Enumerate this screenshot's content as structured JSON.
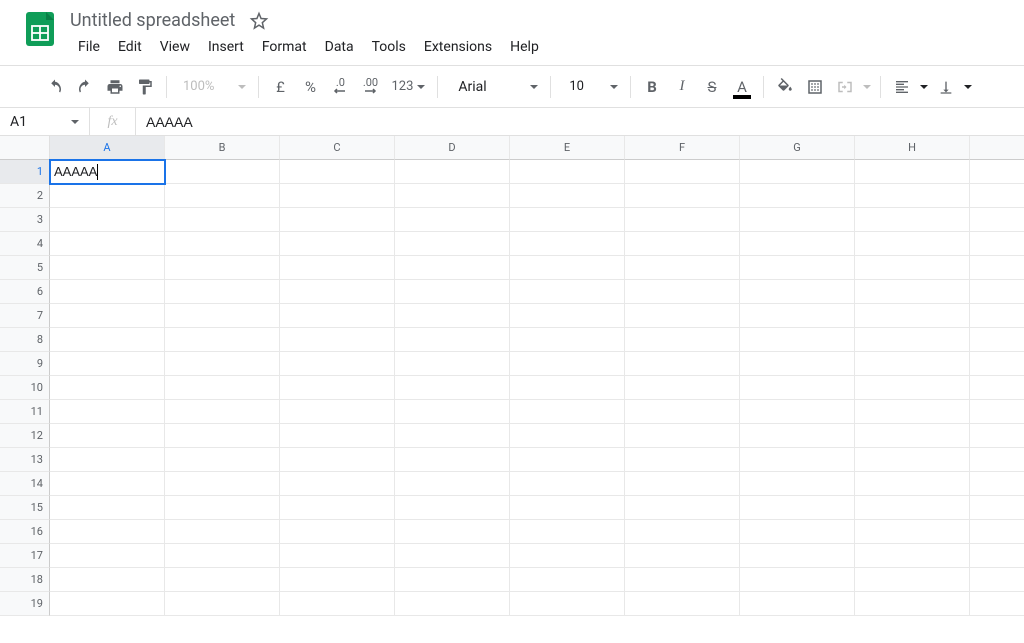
{
  "document": {
    "title": "Untitled spreadsheet"
  },
  "menu": {
    "items": [
      "File",
      "Edit",
      "View",
      "Insert",
      "Format",
      "Data",
      "Tools",
      "Extensions",
      "Help"
    ]
  },
  "toolbar": {
    "zoom": "100%",
    "currency": "£",
    "percent": "%",
    "decrease_decimal": ".0",
    "increase_decimal": ".00",
    "format_123": "123",
    "font": "Arial",
    "font_size": "10",
    "bold": "B",
    "italic": "I",
    "strike": "S"
  },
  "name_box": "A1",
  "formula_bar": {
    "fx": "fx",
    "value": "AAAAA"
  },
  "columns": [
    "A",
    "B",
    "C",
    "D",
    "E",
    "F",
    "G",
    "H"
  ],
  "rows": [
    "1",
    "2",
    "3",
    "4",
    "5",
    "6",
    "7",
    "8",
    "9",
    "10",
    "11",
    "12",
    "13",
    "14",
    "15",
    "16",
    "17",
    "18",
    "19"
  ],
  "active_cell": {
    "row": 0,
    "col": 0,
    "value": "AAAAA"
  }
}
